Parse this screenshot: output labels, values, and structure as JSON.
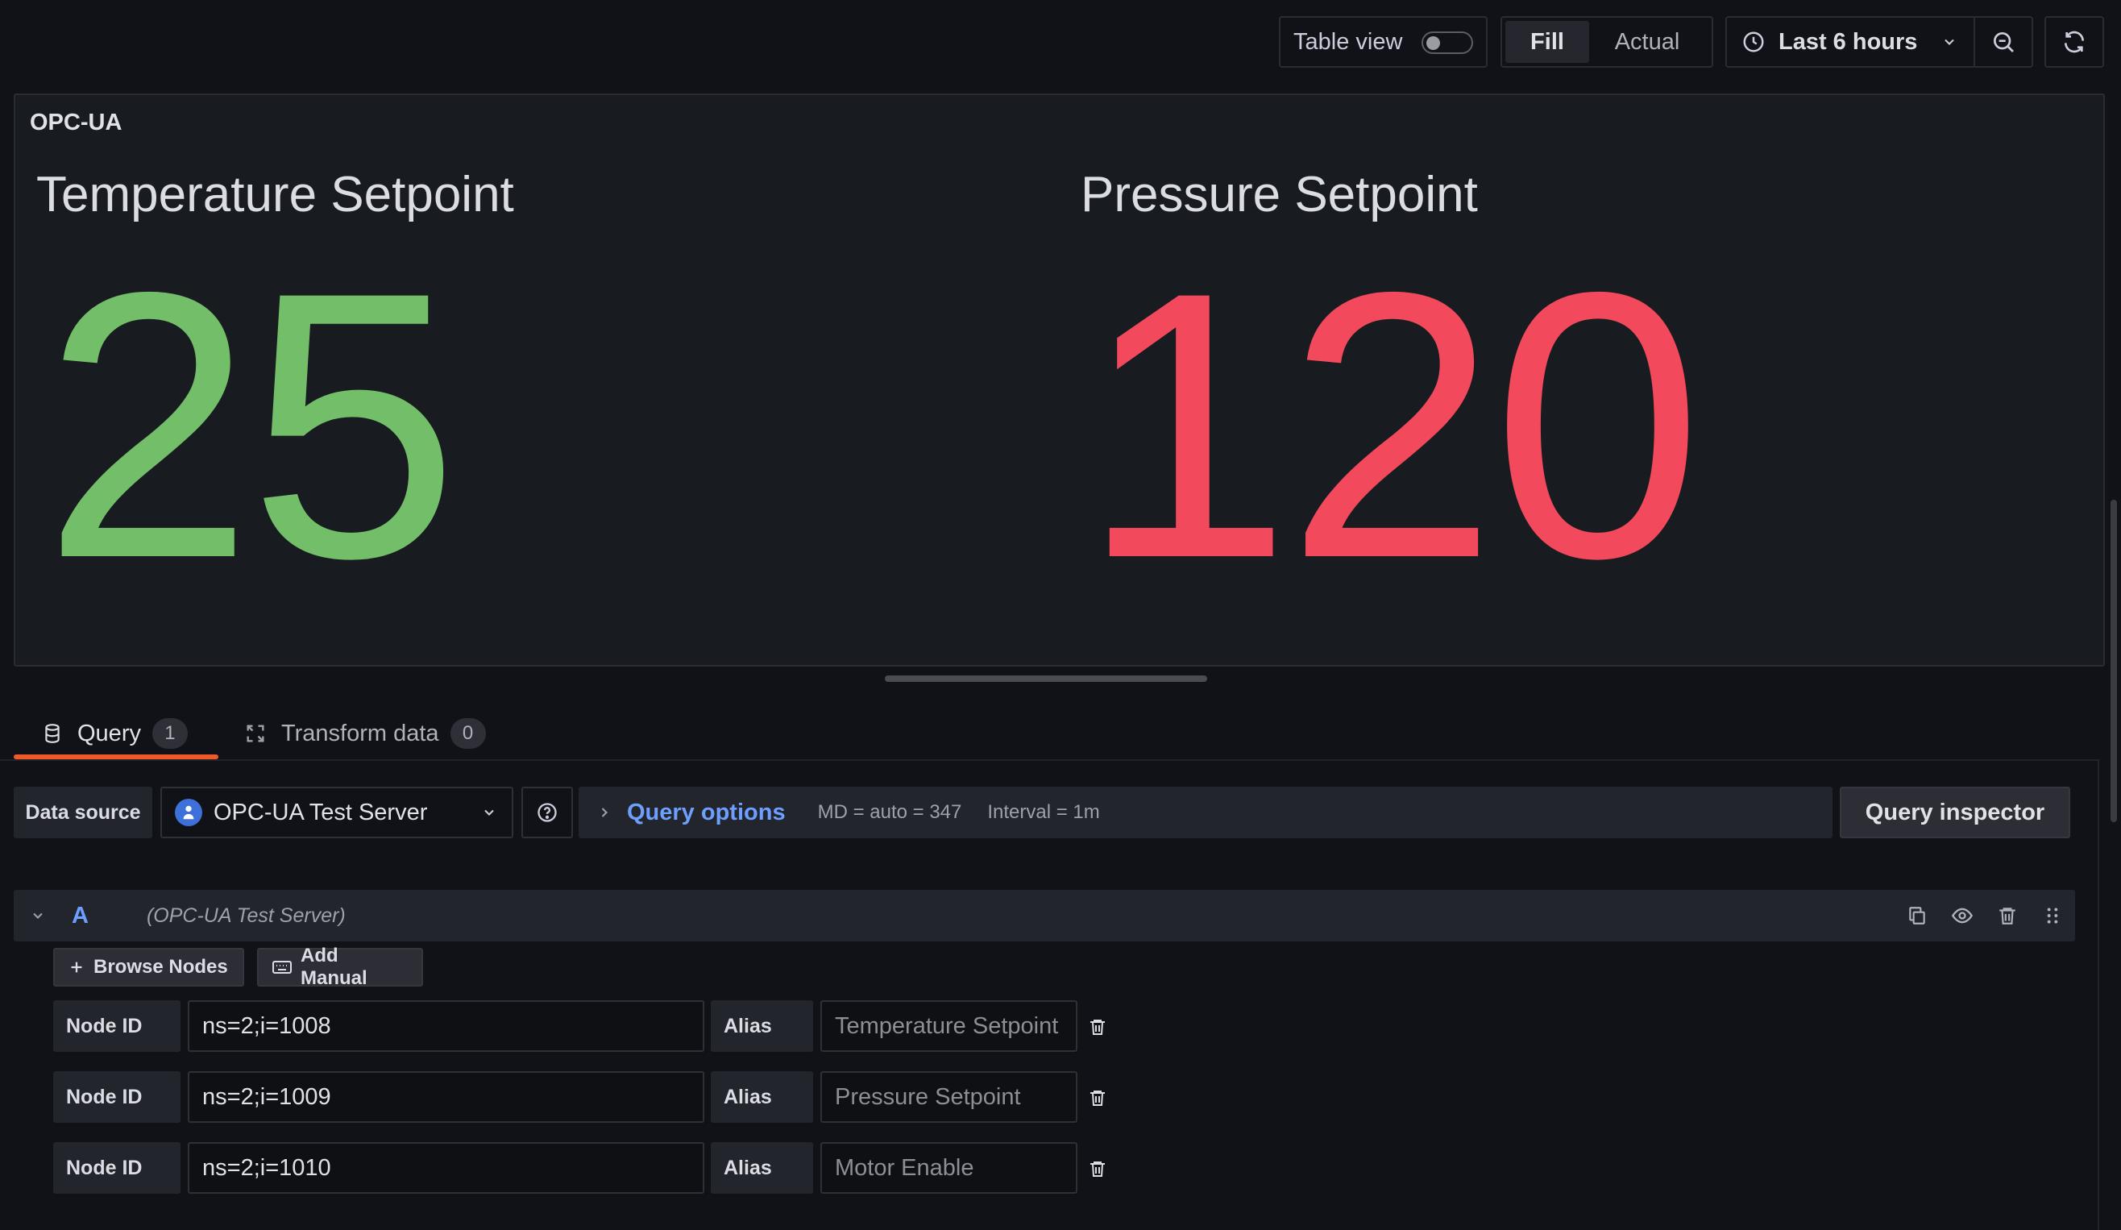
{
  "toolbar": {
    "table_view_label": "Table view",
    "fill_label": "Fill",
    "actual_label": "Actual",
    "time_range": "Last 6 hours"
  },
  "panel": {
    "title": "OPC-UA",
    "stats": [
      {
        "label": "Temperature Setpoint",
        "value": "25",
        "color": "#73bf69"
      },
      {
        "label": "Pressure Setpoint",
        "value": "120",
        "color": "#f2495c"
      }
    ]
  },
  "tabs": [
    {
      "label": "Query",
      "count": "1",
      "active": true
    },
    {
      "label": "Transform data",
      "count": "0",
      "active": false
    }
  ],
  "query_bar": {
    "data_source_label": "Data source",
    "data_source": "OPC-UA Test Server",
    "query_options_label": "Query options",
    "md": "MD = auto = 347",
    "interval": "Interval = 1m",
    "inspector_label": "Query inspector"
  },
  "query_a": {
    "ref_id": "A",
    "ds_hint": "(OPC-UA Test Server)",
    "browse_nodes_label": "Browse Nodes",
    "add_manual_label": "Add Manual",
    "node_id_label": "Node ID",
    "alias_label": "Alias",
    "nodes": [
      {
        "node_id": "ns=2;i=1008",
        "alias": "Temperature Setpoint"
      },
      {
        "node_id": "ns=2;i=1009",
        "alias": "Pressure Setpoint"
      },
      {
        "node_id": "ns=2;i=1010",
        "alias": "Motor Enable"
      }
    ]
  },
  "colors": {
    "accent_blue": "#6e9fff",
    "active_tab_underline": "#f05a28",
    "good": "#73bf69",
    "bad": "#f2495c"
  }
}
